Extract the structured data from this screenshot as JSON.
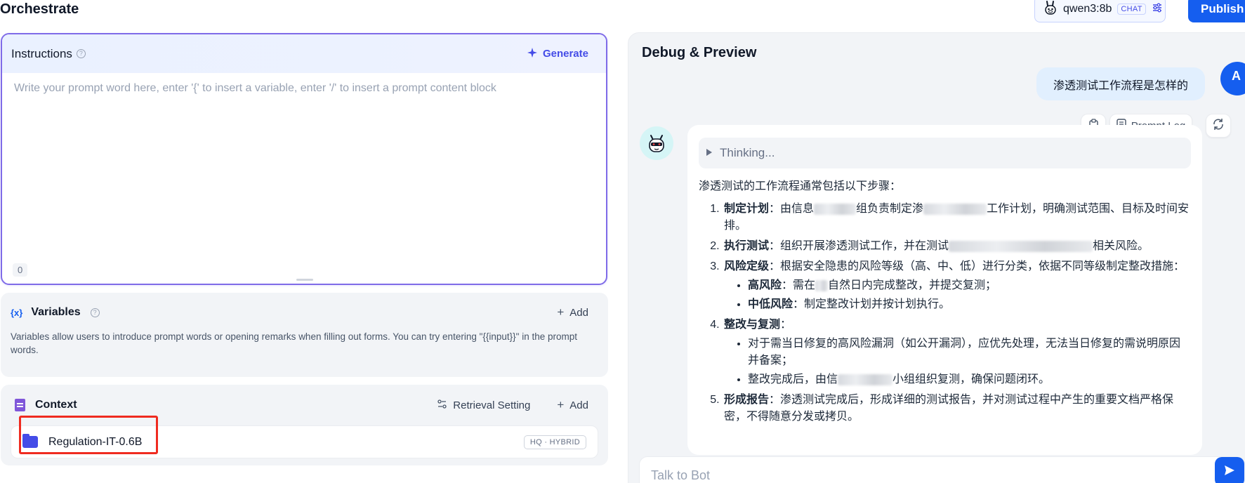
{
  "header": {
    "title": "Orchestrate",
    "model_name": "qwen3:8b",
    "model_mode": "CHAT",
    "publish_label": "Publish"
  },
  "instructions": {
    "label": "Instructions",
    "generate_label": "Generate",
    "placeholder": "Write your prompt word here, enter '{' to insert a variable, enter '/' to insert a prompt content block",
    "char_count": "0"
  },
  "variables": {
    "icon_text": "{x}",
    "title": "Variables",
    "add_label": "Add",
    "description": "Variables allow users to introduce prompt words or opening remarks when filling out forms. You can try entering \"{{input}}\" in the prompt words."
  },
  "context": {
    "title": "Context",
    "retrieval_label": "Retrieval Setting",
    "add_label": "Add",
    "dataset_name": "Regulation-IT-0.6B",
    "dataset_badge": "HQ · HYBRID"
  },
  "debug": {
    "title": "Debug & Preview",
    "user_message": "渗透测试工作流程是怎样的",
    "user_avatar_letter": "A",
    "prompt_log_label": "Prompt Log",
    "thinking_label": "Thinking...",
    "answer_intro": "渗透测试的工作流程通常包括以下步骤：",
    "steps": [
      {
        "title": "制定计划",
        "text_a": "：由信息",
        "text_b": "组负责制定渗",
        "text_c": "工作计划，明确测试范围、目标及时间安排。"
      },
      {
        "title": "执行测试",
        "text_a": "：组织开展渗透测试工作，并在测试",
        "text_c": "相关风险。"
      },
      {
        "title": "风险定级",
        "text": "：根据安全隐患的风险等级（高、中、低）进行分类，依据不同等级制定整改措施：",
        "sub": [
          {
            "title": "高风险",
            "text_a": "：需在",
            "text_c": "自然日内完成整改，并提交复测；"
          },
          {
            "title": "中低风险",
            "text": "：制定整改计划并按计划执行。"
          }
        ]
      },
      {
        "title": "整改与复测",
        "text": "：",
        "sub": [
          {
            "text": "对于需当日修复的高风险漏洞（如公开漏洞），应优先处理，无法当日修复的需说明原因并备案；"
          },
          {
            "text_a": "整改完成后，由信",
            "text_c": "小组组织复测，确保问题闭环。"
          }
        ]
      },
      {
        "title": "形成报告",
        "text": "：渗透测试完成后，形成详细的测试报告，并对测试过程中产生的重要文档严格保密，不得随意分发或拷贝。"
      }
    ],
    "input_placeholder": "Talk to Bot"
  }
}
